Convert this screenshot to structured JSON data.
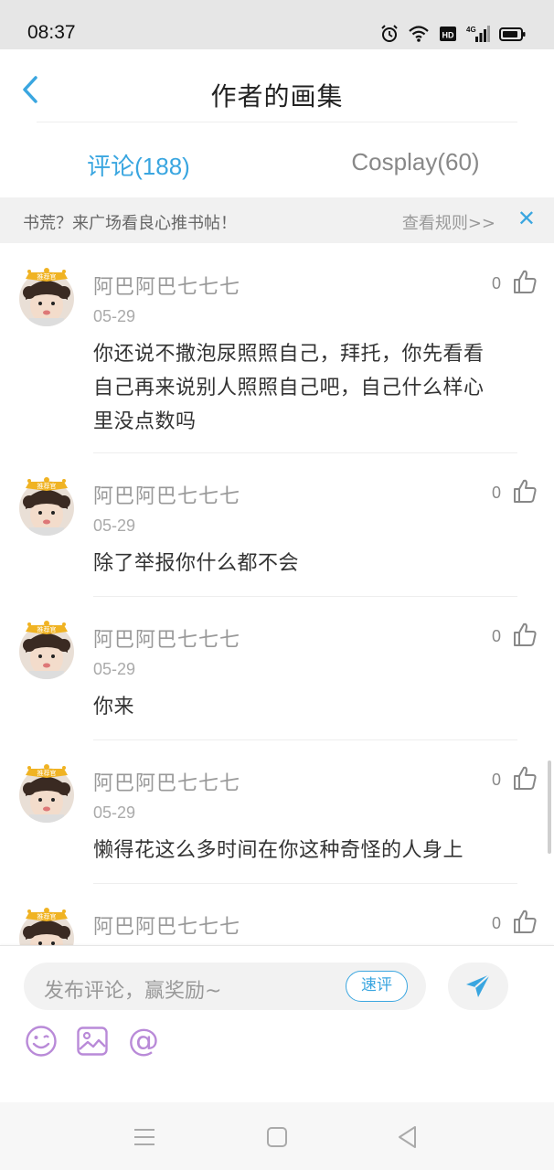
{
  "status_bar": {
    "time": "08:37",
    "icons": [
      "alarm-icon",
      "wifi-icon",
      "hd-icon",
      "signal-4g-icon",
      "battery-icon"
    ],
    "hd_label": "HD",
    "net_label": "4G"
  },
  "header": {
    "title": "作者的画集",
    "back_icon": "chevron-left-icon"
  },
  "tabs": [
    {
      "label": "评论(188)",
      "active": true
    },
    {
      "label": "Cosplay(60)",
      "active": false
    }
  ],
  "notice": {
    "text": "书荒？来广场看良心推书帖！",
    "link": "查看规则>>",
    "close": "✕"
  },
  "comments": [
    {
      "username": "阿巴阿巴七七七",
      "date": "05-29",
      "likes": "0",
      "lines": [
        "你还说不撒泡尿照照自己，拜托，你先看看",
        "自己再来说别人照照自己吧，自己什么样心",
        "里没点数吗"
      ],
      "badge": "推荐官"
    },
    {
      "username": "阿巴阿巴七七七",
      "date": "05-29",
      "likes": "0",
      "lines": [
        "除了举报你什么都不会"
      ],
      "badge": "推荐官"
    },
    {
      "username": "阿巴阿巴七七七",
      "date": "05-29",
      "likes": "0",
      "lines": [
        "你来"
      ],
      "badge": "推荐官"
    },
    {
      "username": "阿巴阿巴七七七",
      "date": "05-29",
      "likes": "0",
      "lines": [
        "懒得花这么多时间在你这种奇怪的人身上"
      ],
      "badge": "推荐官"
    },
    {
      "username": "阿巴阿巴七七七",
      "date": "",
      "likes": "0",
      "lines": [],
      "badge": "推荐官"
    }
  ],
  "composer": {
    "placeholder": "发布评论，赢奖励~",
    "quick_label": "速评",
    "tools": [
      "emoji-icon",
      "image-icon",
      "mention-icon"
    ],
    "mention_glyph": "@"
  },
  "colors": {
    "accent": "#3aa6e0",
    "tool_purple": "#b98ad8",
    "badge_gold": "#f0b323"
  }
}
